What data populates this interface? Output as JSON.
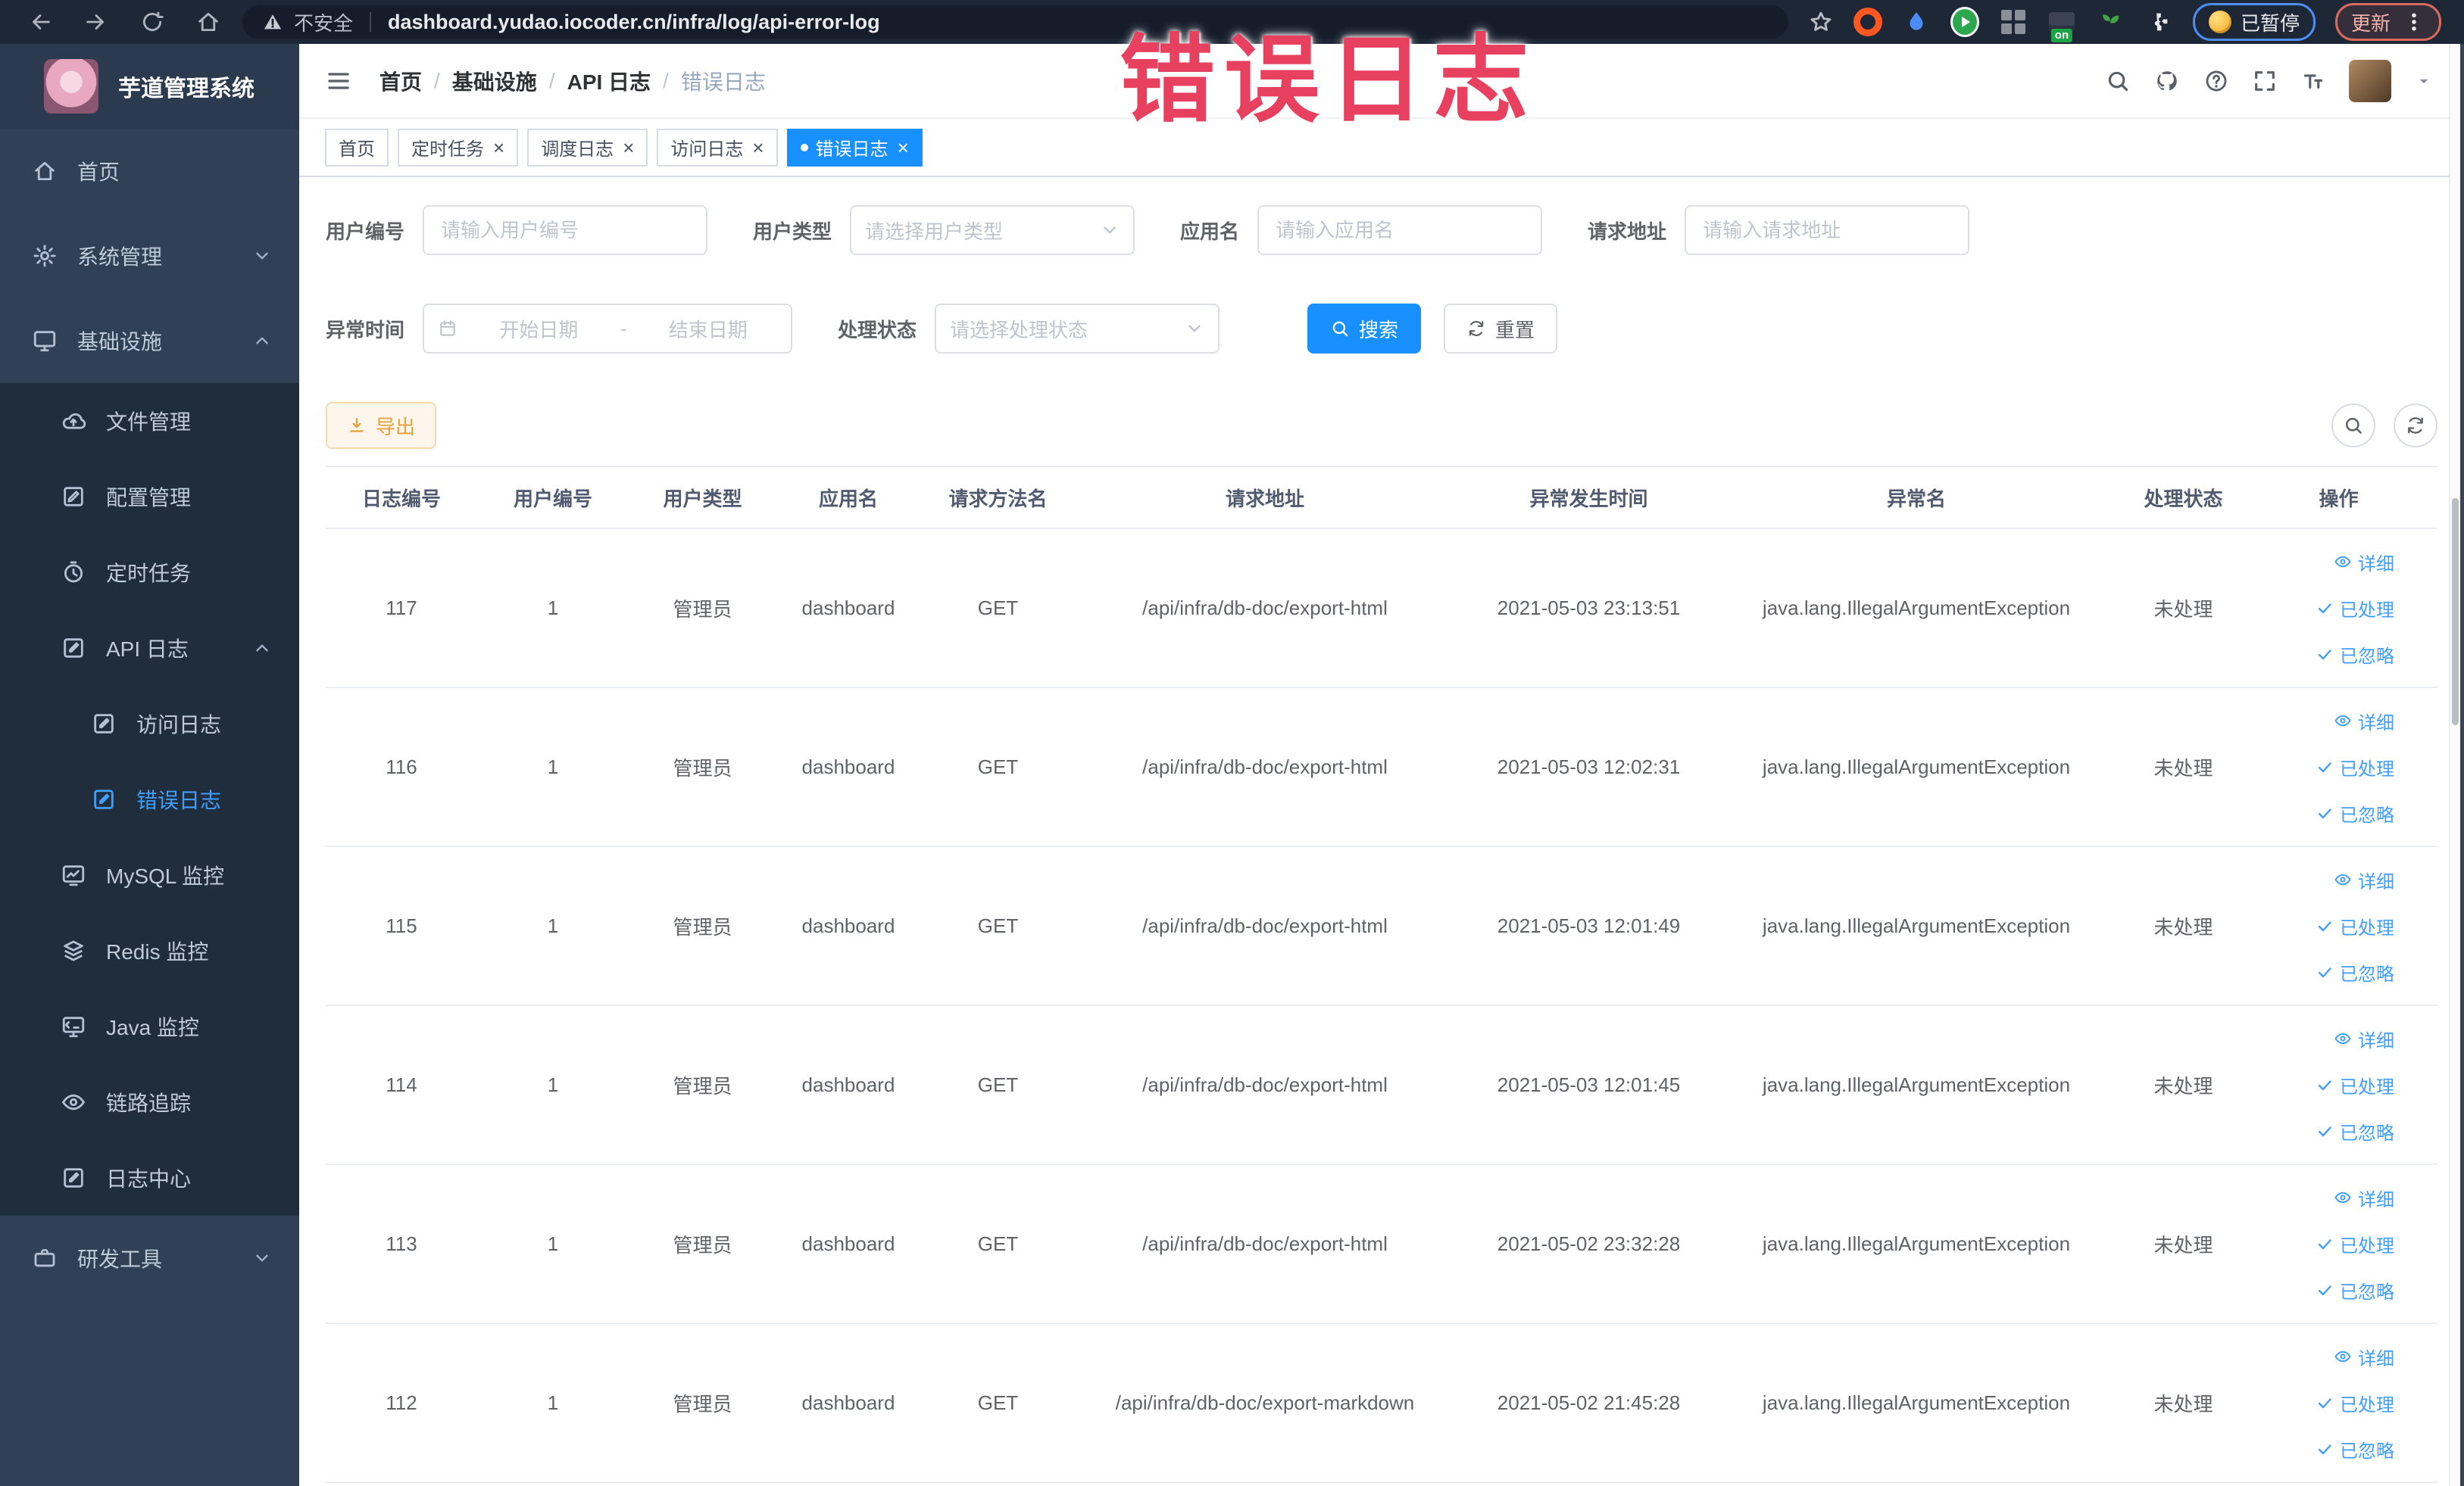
{
  "chrome": {
    "security_label": "不安全",
    "url": "dashboard.yudao.iocoder.cn/infra/log/api-error-log",
    "extension_badge": "on",
    "paused_pill": "已暂停",
    "update_pill": "更新"
  },
  "annotation": {
    "text": "错误日志",
    "color": "#e8415f"
  },
  "colors": {
    "accent": "#1890ff",
    "link": "#409eff",
    "sidebar_bg": "#304156",
    "submenu_bg": "#1f2d3d",
    "sidebar_active": "#409eff",
    "warning_text": "#e6a23c"
  },
  "sidebar": {
    "title": "芋道管理系统",
    "items": [
      {
        "label": "首页",
        "icon": "home",
        "depth": "d0"
      },
      {
        "label": "系统管理",
        "icon": "gear",
        "depth": "d0",
        "arrow": "down"
      },
      {
        "label": "基础设施",
        "icon": "monitor",
        "depth": "d0",
        "arrow": "up"
      },
      {
        "label": "文件管理",
        "icon": "cloud",
        "depth": "d1"
      },
      {
        "label": "配置管理",
        "icon": "edit",
        "depth": "d1"
      },
      {
        "label": "定时任务",
        "icon": "timer",
        "depth": "d1"
      },
      {
        "label": "API 日志",
        "icon": "log",
        "depth": "d1",
        "arrow": "up"
      },
      {
        "label": "访问日志",
        "icon": "log",
        "depth": "d2"
      },
      {
        "label": "错误日志",
        "icon": "log",
        "depth": "d2",
        "active": true
      },
      {
        "label": "MySQL 监控",
        "icon": "chart",
        "depth": "d1"
      },
      {
        "label": "Redis 监控",
        "icon": "layers",
        "depth": "d1"
      },
      {
        "label": "Java 监控",
        "icon": "java",
        "depth": "d1"
      },
      {
        "label": "链路追踪",
        "icon": "eye",
        "depth": "d1"
      },
      {
        "label": "日志中心",
        "icon": "log",
        "depth": "d1"
      },
      {
        "label": "研发工具",
        "icon": "tool",
        "depth": "d0",
        "arrow": "down"
      }
    ]
  },
  "breadcrumb": {
    "items": [
      {
        "label": "首页"
      },
      {
        "label": "基础设施"
      },
      {
        "label": "API 日志"
      },
      {
        "label": "错误日志",
        "current": true
      }
    ]
  },
  "tags": [
    {
      "label": "首页"
    },
    {
      "label": "定时任务",
      "closable": true
    },
    {
      "label": "调度日志",
      "closable": true
    },
    {
      "label": "访问日志",
      "closable": true
    },
    {
      "label": "错误日志",
      "closable": true,
      "active": true
    }
  ],
  "filters": {
    "user_id": {
      "label": "用户编号",
      "placeholder": "请输入用户编号"
    },
    "user_type": {
      "label": "用户类型",
      "placeholder": "请选择用户类型"
    },
    "app_name": {
      "label": "应用名",
      "placeholder": "请输入应用名"
    },
    "request_url": {
      "label": "请求地址",
      "placeholder": "请输入请求地址"
    },
    "exception_time": {
      "label": "异常时间",
      "start_placeholder": "开始日期",
      "separator": "-",
      "end_placeholder": "结束日期"
    },
    "process_status": {
      "label": "处理状态",
      "placeholder": "请选择处理状态"
    },
    "search_label": "搜索",
    "reset_label": "重置"
  },
  "toolbar": {
    "export_label": "导出"
  },
  "table": {
    "columns": [
      "日志编号",
      "用户编号",
      "用户类型",
      "应用名",
      "请求方法名",
      "请求地址",
      "异常发生时间",
      "异常名",
      "处理状态",
      "操作"
    ],
    "actions": [
      {
        "label": "详细"
      },
      {
        "label": "已处理"
      },
      {
        "label": "已忽略"
      }
    ],
    "rows": [
      {
        "id": "117",
        "user_id": "1",
        "user_type": "管理员",
        "app_name": "dashboard",
        "method": "GET",
        "url": "/api/infra/db-doc/export-html",
        "time": "2021-05-03 23:13:51",
        "exception": "java.lang.IllegalArgumentException",
        "status": "未处理"
      },
      {
        "id": "116",
        "user_id": "1",
        "user_type": "管理员",
        "app_name": "dashboard",
        "method": "GET",
        "url": "/api/infra/db-doc/export-html",
        "time": "2021-05-03 12:02:31",
        "exception": "java.lang.IllegalArgumentException",
        "status": "未处理"
      },
      {
        "id": "115",
        "user_id": "1",
        "user_type": "管理员",
        "app_name": "dashboard",
        "method": "GET",
        "url": "/api/infra/db-doc/export-html",
        "time": "2021-05-03 12:01:49",
        "exception": "java.lang.IllegalArgumentException",
        "status": "未处理"
      },
      {
        "id": "114",
        "user_id": "1",
        "user_type": "管理员",
        "app_name": "dashboard",
        "method": "GET",
        "url": "/api/infra/db-doc/export-html",
        "time": "2021-05-03 12:01:45",
        "exception": "java.lang.IllegalArgumentException",
        "status": "未处理"
      },
      {
        "id": "113",
        "user_id": "1",
        "user_type": "管理员",
        "app_name": "dashboard",
        "method": "GET",
        "url": "/api/infra/db-doc/export-html",
        "time": "2021-05-02 23:32:28",
        "exception": "java.lang.IllegalArgumentException",
        "status": "未处理"
      },
      {
        "id": "112",
        "user_id": "1",
        "user_type": "管理员",
        "app_name": "dashboard",
        "method": "GET",
        "url": "/api/infra/db-doc/export-markdown",
        "time": "2021-05-02 21:45:28",
        "exception": "java.lang.IllegalArgumentException",
        "status": "未处理"
      }
    ]
  }
}
